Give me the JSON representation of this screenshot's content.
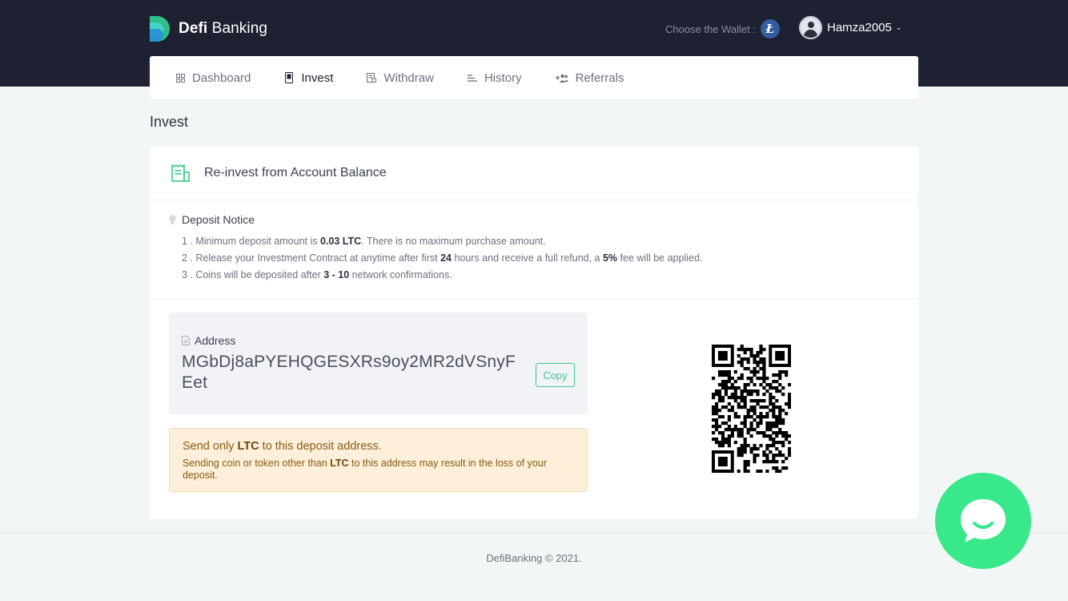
{
  "app": {
    "logo_bold": "Defi",
    "logo_rest": " Banking"
  },
  "header": {
    "wallet_label": "Choose the Wallet :",
    "wallet_coin_glyph": "Ł",
    "username": "Hamza2005",
    "chevron": "⌄"
  },
  "nav": {
    "items": [
      {
        "label": "Dashboard",
        "icon": "grid-icon",
        "active": false
      },
      {
        "label": "Invest",
        "icon": "invest-icon",
        "active": true
      },
      {
        "label": "Withdraw",
        "icon": "receipt-icon",
        "active": false
      },
      {
        "label": "History",
        "icon": "list-icon",
        "active": false
      },
      {
        "label": "Referrals",
        "icon": "add-user-icon",
        "active": false
      }
    ]
  },
  "page": {
    "title": "Invest"
  },
  "card": {
    "header_title": "Re-invest from Account Balance",
    "notice_title": "Deposit Notice",
    "notice": {
      "line1_pre": "1 . Minimum deposit amount is ",
      "line1_bold": "0.03 LTC",
      "line1_post": ". There is no maximum purchase amount.",
      "line2_pre": "2 . Release your Investment Contract at anytime after first ",
      "line2_bold1": "24",
      "line2_mid": " hours and receive a full refund, a ",
      "line2_bold2": "5%",
      "line2_post": " fee will be applied.",
      "line3_pre": "3 . Coins will be deposited after ",
      "line3_bold": "3 - 10",
      "line3_post": " network confirmations."
    },
    "address_label": "Address",
    "address_value": "MGbDj8aPYEHQGESXRs9oy2MR2dVSnyFEet",
    "copy_label": "Copy",
    "warning": {
      "title_pre": "Send only ",
      "title_bold": "LTC",
      "title_post": " to this deposit address.",
      "sub_pre": "Sending coin or token other than ",
      "sub_bold": "LTC",
      "sub_post": " to this address may result in the loss of your deposit."
    }
  },
  "footer": {
    "text": "DefiBanking © 2021."
  },
  "colors": {
    "header_bg": "#1d2131",
    "accent_green": "#3cc98e",
    "chat_green": "#38e88a",
    "warning_bg": "#fdefd9",
    "ltc_blue": "#345d9d"
  }
}
